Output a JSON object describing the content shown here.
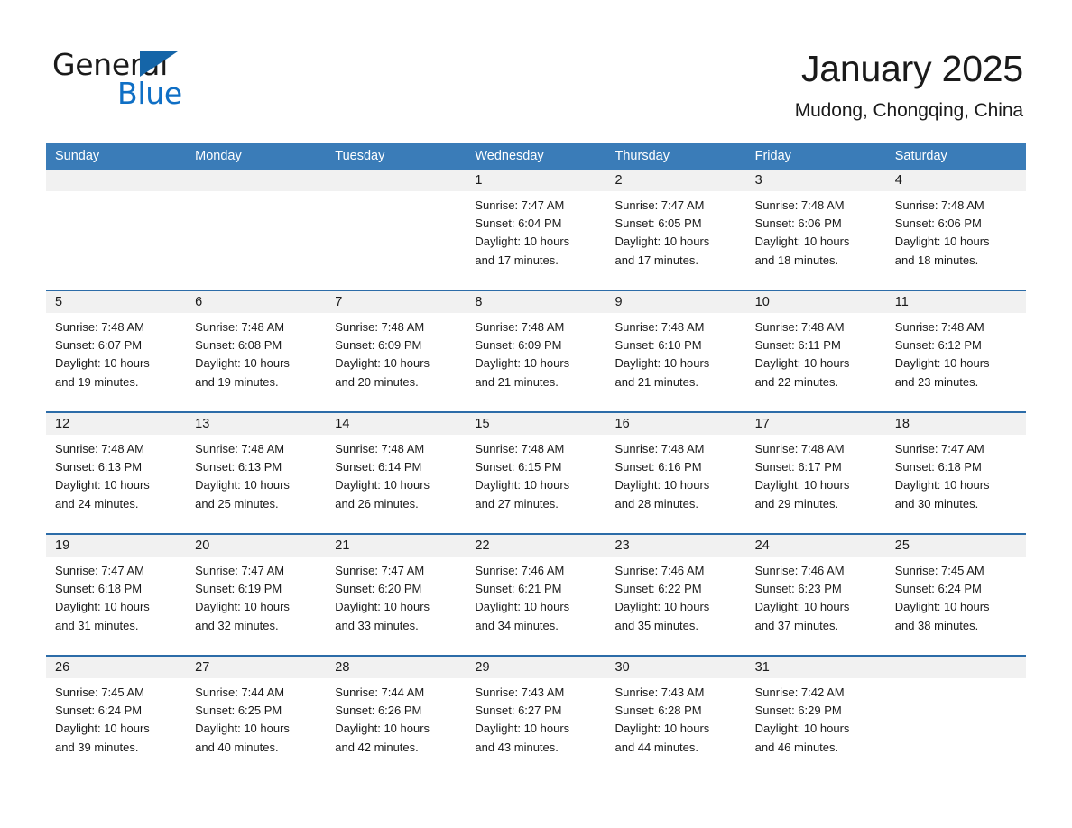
{
  "brand": {
    "name_part1": "General",
    "name_part2": "Blue",
    "triangle_icon": "triangle-icon",
    "accent_color": "#0f6fc5"
  },
  "header": {
    "title": "January 2025",
    "location": "Mudong, Chongqing, China"
  },
  "calendar": {
    "header_bg": "#3a7cb8",
    "row_divider_color": "#2c6ca8",
    "day_number_band_bg": "#f1f1f1",
    "weekdays": [
      "Sunday",
      "Monday",
      "Tuesday",
      "Wednesday",
      "Thursday",
      "Friday",
      "Saturday"
    ],
    "weeks": [
      [
        {
          "day": "",
          "lines": []
        },
        {
          "day": "",
          "lines": []
        },
        {
          "day": "",
          "lines": []
        },
        {
          "day": "1",
          "lines": [
            "Sunrise: 7:47 AM",
            "Sunset: 6:04 PM",
            "Daylight: 10 hours",
            "and 17 minutes."
          ]
        },
        {
          "day": "2",
          "lines": [
            "Sunrise: 7:47 AM",
            "Sunset: 6:05 PM",
            "Daylight: 10 hours",
            "and 17 minutes."
          ]
        },
        {
          "day": "3",
          "lines": [
            "Sunrise: 7:48 AM",
            "Sunset: 6:06 PM",
            "Daylight: 10 hours",
            "and 18 minutes."
          ]
        },
        {
          "day": "4",
          "lines": [
            "Sunrise: 7:48 AM",
            "Sunset: 6:06 PM",
            "Daylight: 10 hours",
            "and 18 minutes."
          ]
        }
      ],
      [
        {
          "day": "5",
          "lines": [
            "Sunrise: 7:48 AM",
            "Sunset: 6:07 PM",
            "Daylight: 10 hours",
            "and 19 minutes."
          ]
        },
        {
          "day": "6",
          "lines": [
            "Sunrise: 7:48 AM",
            "Sunset: 6:08 PM",
            "Daylight: 10 hours",
            "and 19 minutes."
          ]
        },
        {
          "day": "7",
          "lines": [
            "Sunrise: 7:48 AM",
            "Sunset: 6:09 PM",
            "Daylight: 10 hours",
            "and 20 minutes."
          ]
        },
        {
          "day": "8",
          "lines": [
            "Sunrise: 7:48 AM",
            "Sunset: 6:09 PM",
            "Daylight: 10 hours",
            "and 21 minutes."
          ]
        },
        {
          "day": "9",
          "lines": [
            "Sunrise: 7:48 AM",
            "Sunset: 6:10 PM",
            "Daylight: 10 hours",
            "and 21 minutes."
          ]
        },
        {
          "day": "10",
          "lines": [
            "Sunrise: 7:48 AM",
            "Sunset: 6:11 PM",
            "Daylight: 10 hours",
            "and 22 minutes."
          ]
        },
        {
          "day": "11",
          "lines": [
            "Sunrise: 7:48 AM",
            "Sunset: 6:12 PM",
            "Daylight: 10 hours",
            "and 23 minutes."
          ]
        }
      ],
      [
        {
          "day": "12",
          "lines": [
            "Sunrise: 7:48 AM",
            "Sunset: 6:13 PM",
            "Daylight: 10 hours",
            "and 24 minutes."
          ]
        },
        {
          "day": "13",
          "lines": [
            "Sunrise: 7:48 AM",
            "Sunset: 6:13 PM",
            "Daylight: 10 hours",
            "and 25 minutes."
          ]
        },
        {
          "day": "14",
          "lines": [
            "Sunrise: 7:48 AM",
            "Sunset: 6:14 PM",
            "Daylight: 10 hours",
            "and 26 minutes."
          ]
        },
        {
          "day": "15",
          "lines": [
            "Sunrise: 7:48 AM",
            "Sunset: 6:15 PM",
            "Daylight: 10 hours",
            "and 27 minutes."
          ]
        },
        {
          "day": "16",
          "lines": [
            "Sunrise: 7:48 AM",
            "Sunset: 6:16 PM",
            "Daylight: 10 hours",
            "and 28 minutes."
          ]
        },
        {
          "day": "17",
          "lines": [
            "Sunrise: 7:48 AM",
            "Sunset: 6:17 PM",
            "Daylight: 10 hours",
            "and 29 minutes."
          ]
        },
        {
          "day": "18",
          "lines": [
            "Sunrise: 7:47 AM",
            "Sunset: 6:18 PM",
            "Daylight: 10 hours",
            "and 30 minutes."
          ]
        }
      ],
      [
        {
          "day": "19",
          "lines": [
            "Sunrise: 7:47 AM",
            "Sunset: 6:18 PM",
            "Daylight: 10 hours",
            "and 31 minutes."
          ]
        },
        {
          "day": "20",
          "lines": [
            "Sunrise: 7:47 AM",
            "Sunset: 6:19 PM",
            "Daylight: 10 hours",
            "and 32 minutes."
          ]
        },
        {
          "day": "21",
          "lines": [
            "Sunrise: 7:47 AM",
            "Sunset: 6:20 PM",
            "Daylight: 10 hours",
            "and 33 minutes."
          ]
        },
        {
          "day": "22",
          "lines": [
            "Sunrise: 7:46 AM",
            "Sunset: 6:21 PM",
            "Daylight: 10 hours",
            "and 34 minutes."
          ]
        },
        {
          "day": "23",
          "lines": [
            "Sunrise: 7:46 AM",
            "Sunset: 6:22 PM",
            "Daylight: 10 hours",
            "and 35 minutes."
          ]
        },
        {
          "day": "24",
          "lines": [
            "Sunrise: 7:46 AM",
            "Sunset: 6:23 PM",
            "Daylight: 10 hours",
            "and 37 minutes."
          ]
        },
        {
          "day": "25",
          "lines": [
            "Sunrise: 7:45 AM",
            "Sunset: 6:24 PM",
            "Daylight: 10 hours",
            "and 38 minutes."
          ]
        }
      ],
      [
        {
          "day": "26",
          "lines": [
            "Sunrise: 7:45 AM",
            "Sunset: 6:24 PM",
            "Daylight: 10 hours",
            "and 39 minutes."
          ]
        },
        {
          "day": "27",
          "lines": [
            "Sunrise: 7:44 AM",
            "Sunset: 6:25 PM",
            "Daylight: 10 hours",
            "and 40 minutes."
          ]
        },
        {
          "day": "28",
          "lines": [
            "Sunrise: 7:44 AM",
            "Sunset: 6:26 PM",
            "Daylight: 10 hours",
            "and 42 minutes."
          ]
        },
        {
          "day": "29",
          "lines": [
            "Sunrise: 7:43 AM",
            "Sunset: 6:27 PM",
            "Daylight: 10 hours",
            "and 43 minutes."
          ]
        },
        {
          "day": "30",
          "lines": [
            "Sunrise: 7:43 AM",
            "Sunset: 6:28 PM",
            "Daylight: 10 hours",
            "and 44 minutes."
          ]
        },
        {
          "day": "31",
          "lines": [
            "Sunrise: 7:42 AM",
            "Sunset: 6:29 PM",
            "Daylight: 10 hours",
            "and 46 minutes."
          ]
        },
        {
          "day": "",
          "lines": []
        }
      ]
    ]
  }
}
